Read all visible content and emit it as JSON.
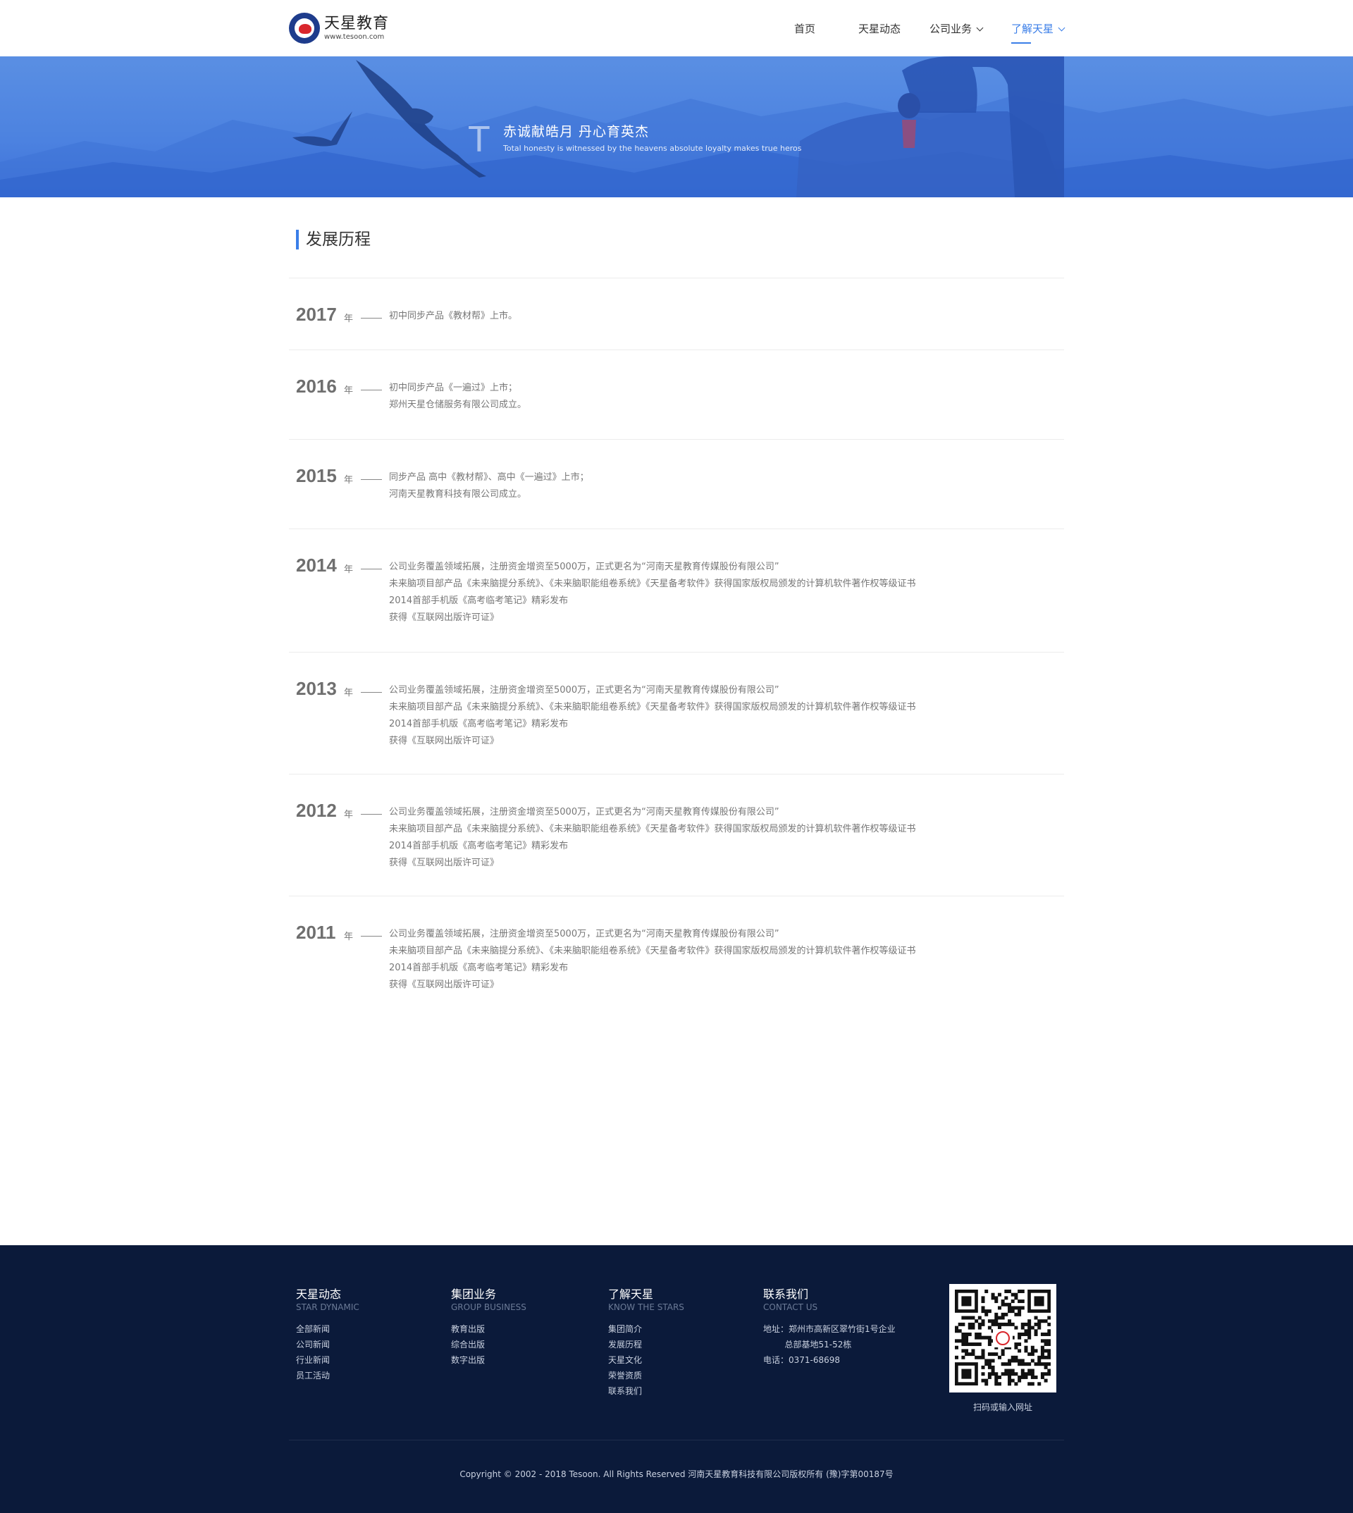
{
  "header": {
    "logo_name": "天星教育",
    "logo_url": "www.tesoon.com",
    "nav": [
      {
        "label": "首页"
      },
      {
        "label": "天星动态"
      },
      {
        "label": "公司业务"
      },
      {
        "label": "了解天星"
      }
    ],
    "accent_color": "#3a7ee8"
  },
  "banner": {
    "letter": "T",
    "title": "赤诚献皓月  丹心育英杰",
    "subtitle": "Total honesty is witnessed by the heavens absolute loyalty makes true heros"
  },
  "section": {
    "title": "发展历程"
  },
  "timeline": [
    {
      "year": "2017",
      "unit": "年",
      "lines": [
        "初中同步产品《教材帮》上市。"
      ]
    },
    {
      "year": "2016",
      "unit": "年",
      "lines": [
        "初中同步产品《一遍过》上市；",
        "郑州天星仓储服务有限公司成立。"
      ]
    },
    {
      "year": "2015",
      "unit": "年",
      "lines": [
        "同步产品 高中《教材帮》、高中《一遍过》上市；",
        "河南天星教育科技有限公司成立。"
      ]
    },
    {
      "year": "2014",
      "unit": "年",
      "lines": [
        "公司业务覆盖领域拓展，注册资金增资至5000万，正式更名为“河南天星教育传媒股份有限公司”",
        "未来脑项目部产品《未来脑提分系统》、《未来脑职能组卷系统》《天星备考软件》获得国家版权局颁发的计算机软件著作权等级证书",
        "2014首部手机版《高考临考笔记》精彩发布",
        "获得《互联网出版许可证》"
      ]
    },
    {
      "year": "2013",
      "unit": "年",
      "lines": [
        "公司业务覆盖领域拓展，注册资金增资至5000万，正式更名为“河南天星教育传媒股份有限公司”",
        "未来脑项目部产品《未来脑提分系统》、《未来脑职能组卷系统》《天星备考软件》获得国家版权局颁发的计算机软件著作权等级证书",
        "2014首部手机版《高考临考笔记》精彩发布",
        "获得《互联网出版许可证》"
      ]
    },
    {
      "year": "2012",
      "unit": "年",
      "lines": [
        "公司业务覆盖领域拓展，注册资金增资至5000万，正式更名为“河南天星教育传媒股份有限公司”",
        "未来脑项目部产品《未来脑提分系统》、《未来脑职能组卷系统》《天星备考软件》获得国家版权局颁发的计算机软件著作权等级证书",
        "2014首部手机版《高考临考笔记》精彩发布",
        "获得《互联网出版许可证》"
      ]
    },
    {
      "year": "2011",
      "unit": "年",
      "lines": [
        "公司业务覆盖领域拓展，注册资金增资至5000万，正式更名为“河南天星教育传媒股份有限公司”",
        "未来脑项目部产品《未来脑提分系统》、《未来脑职能组卷系统》《天星备考软件》获得国家版权局颁发的计算机软件著作权等级证书",
        "2014首部手机版《高考临考笔记》精彩发布",
        "获得《互联网出版许可证》"
      ]
    }
  ],
  "footer": {
    "columns": [
      {
        "title": "天星动态",
        "subtitle": "STAR DYNAMIC",
        "links": [
          "全部新闻",
          "公司新闻",
          "行业新闻",
          "员工活动"
        ]
      },
      {
        "title": "集团业务",
        "subtitle": "GROUP BUSINESS",
        "links": [
          "教育出版",
          "综合出版",
          "数字出版"
        ]
      },
      {
        "title": "了解天星",
        "subtitle": "KNOW THE STARS",
        "links": [
          "集团简介",
          "发展历程",
          "天星文化",
          "荣誉资质",
          "联系我们"
        ]
      },
      {
        "title": "联系我们",
        "subtitle": "CONTACT US",
        "links": [
          "地址：郑州市高新区翠竹街1号企业",
          "        总部基地51-52栋",
          "电话：0371-68698"
        ]
      }
    ],
    "qr_caption": "扫码或输入网址",
    "copyright": "Copyright © 2002 - 2018 Tesoon. All Rights Reserved  河南天星教育科技有限公司版权所有 (豫)字第00187号",
    "background": "#0b1a3a"
  }
}
